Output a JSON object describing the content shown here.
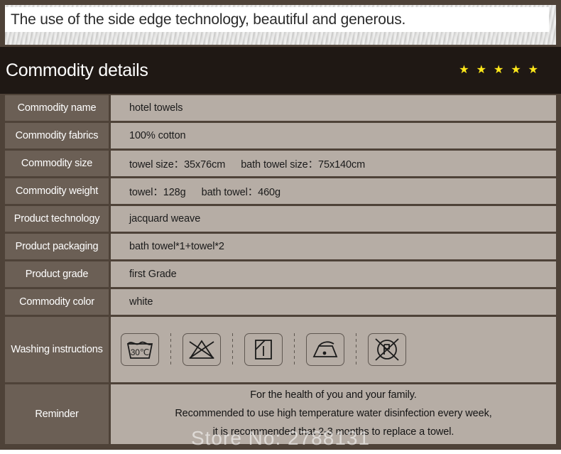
{
  "banner": {
    "text": "The use of the side edge technology, beautiful and generous."
  },
  "header": {
    "title": "Commodity details",
    "star_glyph": "★",
    "star_count": 5,
    "star_color": "#ffe81a",
    "background_color": "#1f1814"
  },
  "colors": {
    "frame": "#4e4238",
    "label_cell": "#6b5f55",
    "value_cell": "#b6ada5",
    "text_dark": "#1b1b1b",
    "text_light": "#ffffff"
  },
  "table": {
    "rows": [
      {
        "label": "Commodity name",
        "value": "hotel towels"
      },
      {
        "label": "Commodity fabrics",
        "value": "100% cotton"
      },
      {
        "label": "Commodity size",
        "value": "towel size：35x76cm",
        "value2": "bath towel size：75x140cm"
      },
      {
        "label": "Commodity weight",
        "value": "towel：128g",
        "value2": "bath towel：460g"
      },
      {
        "label": "Product technology",
        "value": "jacquard weave"
      },
      {
        "label": "Product packaging",
        "value": "bath towel*1+towel*2"
      },
      {
        "label": "Product grade",
        "value": "first Grade"
      },
      {
        "label": "Commodity color",
        "value": "white"
      }
    ],
    "washing": {
      "label": "Washing instructions",
      "icons": [
        {
          "name": "wash-30c-icon",
          "text": "30℃"
        },
        {
          "name": "do-not-bleach-icon",
          "text": ""
        },
        {
          "name": "line-dry-icon",
          "text": ""
        },
        {
          "name": "iron-low-heat-icon",
          "text": ""
        },
        {
          "name": "do-not-dry-clean-icon",
          "text": ""
        }
      ]
    },
    "reminder": {
      "label": "Reminder",
      "lines": [
        "For the health of you and your family.",
        "Recommended to use high temperature water disinfection every week,",
        "it is recommended that 2-3 months to replace a towel."
      ]
    }
  },
  "watermark": {
    "text": "Store No: 2788131"
  }
}
